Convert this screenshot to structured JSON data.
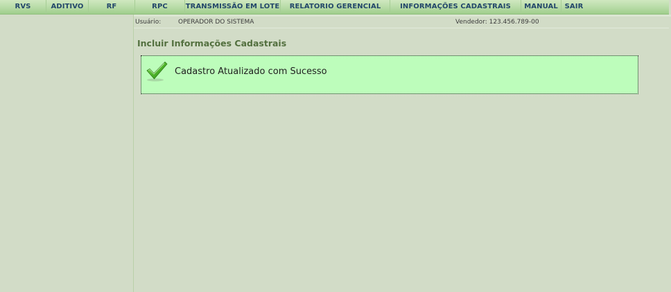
{
  "menu": {
    "items": [
      {
        "label": "RVS"
      },
      {
        "label": "ADITIVO"
      },
      {
        "label": "RF"
      },
      {
        "label": "RPC"
      },
      {
        "label": "TRANSMISSÃO EM LOTE"
      },
      {
        "label": "RELATORIO GERENCIAL"
      },
      {
        "label": "INFORMAÇÕES CADASTRAIS"
      },
      {
        "label": "MANUAL"
      },
      {
        "label": "SAIR"
      }
    ]
  },
  "info": {
    "user_label": "Usuário:",
    "user_value": "OPERADOR DO SISTEMA",
    "vendor": "Vendedor: 123.456.789-00"
  },
  "page": {
    "title": "Incluir Informações Cadastrais",
    "message": "Cadastro Atualizado com Sucesso",
    "message_icon": "check-icon"
  },
  "colors": {
    "background": "#d2dcc7",
    "menu_text": "#23476a",
    "title_text": "#53703f",
    "success_background": "#bdfdbb",
    "check_green": "#3d9a1f"
  }
}
